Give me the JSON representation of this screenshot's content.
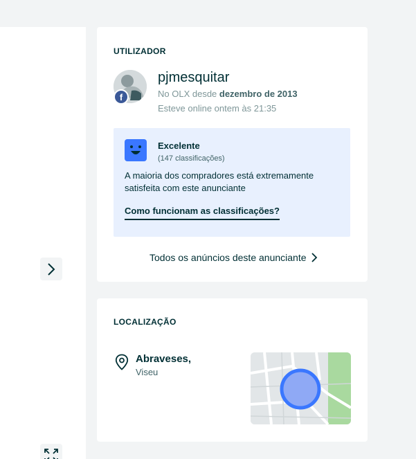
{
  "user_card": {
    "section_title": "UTILIZADOR",
    "avatar_badge": "f",
    "name": "pjmesquitar",
    "since_prefix": "No OLX desde ",
    "since_date": "dezembro de 2013",
    "online_status": "Esteve online ontem às 21:35",
    "rating": {
      "label": "Excelente",
      "count": "(147 classificações)",
      "description": "A maioria dos compradores está extremamente satisfeita com este anunciante",
      "link": "Como funcionam as classificações?"
    },
    "all_ads_link": "Todos os anúncios deste anunciante"
  },
  "location_card": {
    "section_title": "LOCALIZAÇÃO",
    "city": "Abraveses,",
    "region": "Viseu"
  },
  "colors": {
    "accent_blue": "#3a77ff",
    "rating_bg": "#e8f0fe",
    "text_dark": "#002f34",
    "text_muted": "#7f9799",
    "map_green": "#a9d99f"
  },
  "icons": [
    "chevron-right-icon",
    "expand-icon",
    "facebook-icon",
    "smiley-face-icon",
    "location-pin-icon",
    "map-thumbnail"
  ]
}
